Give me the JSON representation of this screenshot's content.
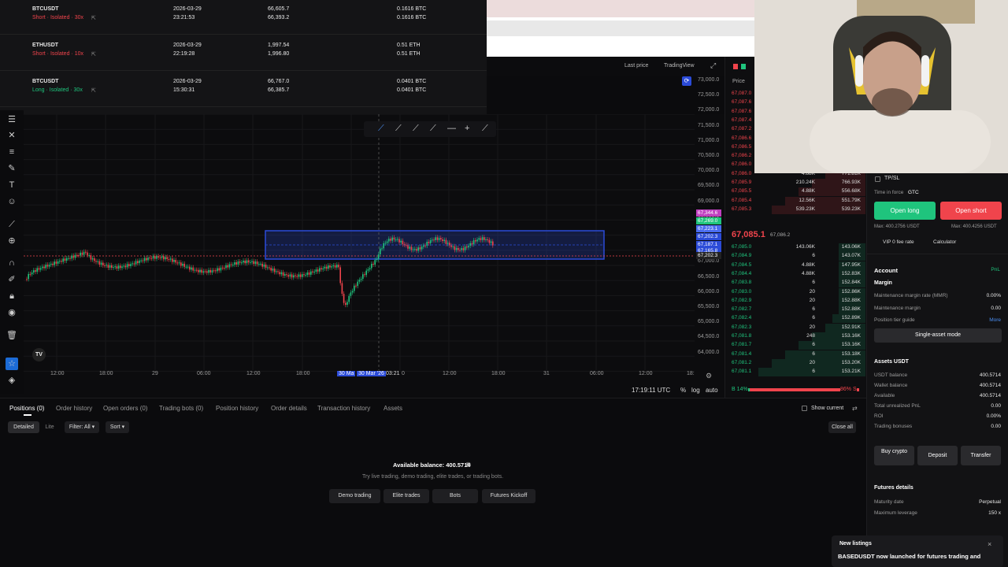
{
  "positions_history": [
    {
      "symbol": "BTCUSDT",
      "type": "Short · Isolated · 30x",
      "side": "short",
      "date": "2026-03-29",
      "time": "23:21:53",
      "open_price": "66,605.7",
      "close_price": "66,393.2",
      "size1": "0.1616 BTC",
      "size2": "0.1616 BTC"
    },
    {
      "symbol": "ETHUSDT",
      "type": "Short · Isolated · 10x",
      "side": "short",
      "date": "2026-03-29",
      "time": "22:19:28",
      "open_price": "1,997.54",
      "close_price": "1,996.80",
      "size1": "0.51 ETH",
      "size2": "0.51 ETH"
    },
    {
      "symbol": "BTCUSDT",
      "type": "Long · Isolated · 30x",
      "side": "long",
      "date": "2026-03-29",
      "time": "15:30:31",
      "open_price": "66,767.0",
      "close_price": "66,385.7",
      "size1": "0.0401 BTC",
      "size2": "0.0401 BTC"
    }
  ],
  "chart": {
    "price_mode": "Last price",
    "view": "TradingView",
    "price_label": "Price",
    "y_ticks": [
      "73,000.0",
      "72,500.0",
      "72,000.0",
      "71,500.0",
      "71,000.0",
      "70,500.0",
      "70,000.0",
      "69,500.0",
      "69,000.0",
      "68,500.0",
      "68,000.0",
      "67,500.0",
      "67,000.0",
      "66,500.0",
      "66,000.0",
      "65,500.0",
      "65,000.0",
      "64,500.0",
      "64,000.0"
    ],
    "x_ticks": [
      "12:00",
      "18:00",
      "29",
      "06:00",
      "12:00",
      "18:00",
      "30 Ma",
      "30 Mar '26",
      "03:21",
      "0",
      "12:00",
      "18:00",
      "31",
      "06:00",
      "12:00",
      "18:"
    ],
    "price_tags": [
      "67,344.6",
      "67,269.0",
      "67,223.1",
      "67,202.3",
      "67,187.1",
      "67,165.8",
      "67,202.3"
    ],
    "clock": "17:19:11 UTC",
    "pct": "%",
    "log": "log",
    "auto": "auto",
    "tv_logo": "TV",
    "colors": {
      "up": "#1fc47d",
      "down": "#f0444c",
      "box": "#2b4bd8"
    }
  },
  "order_book": {
    "asks": [
      [
        "67,087.0",
        "",
        ""
      ],
      [
        "67,087.6",
        "",
        ""
      ],
      [
        "67,087.6",
        "",
        ""
      ],
      [
        "67,087.4",
        "",
        ""
      ],
      [
        "67,087.2",
        "",
        ""
      ],
      [
        "67,086.6",
        "",
        ""
      ],
      [
        "67,086.5",
        "",
        ""
      ],
      [
        "67,086.2",
        "",
        ""
      ],
      [
        "67,086.0",
        "20",
        "771.84K"
      ],
      [
        "67,086.0",
        "4.88K",
        "771.81K"
      ],
      [
        "67,085.9",
        "210.24K",
        "766.93K"
      ],
      [
        "67,085.5",
        "4.88K",
        "556.68K"
      ],
      [
        "67,085.4",
        "12.56K",
        "551.79K"
      ],
      [
        "67,085.3",
        "539.23K",
        "539.23K"
      ]
    ],
    "mid_price": "67,085.1",
    "mid_sub": "67,086.2",
    "bids": [
      [
        "67,085.0",
        "143.06K",
        "143.06K"
      ],
      [
        "67,084.9",
        "6",
        "143.07K"
      ],
      [
        "67,084.5",
        "4.88K",
        "147.95K"
      ],
      [
        "67,084.4",
        "4.88K",
        "152.83K"
      ],
      [
        "67,083.8",
        "6",
        "152.84K"
      ],
      [
        "67,083.0",
        "20",
        "152.86K"
      ],
      [
        "67,082.9",
        "20",
        "152.88K"
      ],
      [
        "67,082.7",
        "6",
        "152.88K"
      ],
      [
        "67,082.4",
        "6",
        "152.89K"
      ],
      [
        "67,082.3",
        "20",
        "152.91K"
      ],
      [
        "67,081.8",
        "248",
        "153.16K"
      ],
      [
        "67,081.7",
        "6",
        "153.16K"
      ],
      [
        "67,081.4",
        "6",
        "153.18K"
      ],
      [
        "67,081.2",
        "20",
        "153.20K"
      ],
      [
        "67,081.1",
        "6",
        "153.21K"
      ]
    ],
    "buy_pct": "B 14%",
    "sell_pct": "86% S"
  },
  "trade_panel": {
    "tpsl": "TP/SL",
    "tif_label": "Time in force",
    "tif_value": "GTC",
    "open_long": "Open long",
    "open_short": "Open short",
    "max_long": "Max: 400.2756 USDT",
    "max_short": "Max: 400.4256 USDT",
    "vip": "VIP 0 fee rate",
    "calculator": "Calculator",
    "account": "Account",
    "pnl": "PnL",
    "margin": "Margin",
    "mmr_label": "Maintenance margin rate (MMR)",
    "mmr_value": "0.00%",
    "mm_label": "Maintenance margin",
    "mm_value": "0.00",
    "tier_label": "Position tier guide",
    "more": "More",
    "single_asset": "Single-asset mode",
    "assets_title": "Assets USDT",
    "assets": [
      [
        "USDT balance",
        "400.5714"
      ],
      [
        "Wallet balance",
        "400.5714"
      ],
      [
        "Available",
        "400.5714"
      ],
      [
        "Total unrealized PnL",
        "0.00"
      ],
      [
        "ROI",
        "0.00%"
      ],
      [
        "Trading bonuses",
        "0.00"
      ]
    ],
    "buy_crypto": "Buy crypto",
    "deposit": "Deposit",
    "transfer": "Transfer",
    "futures_details": "Futures details",
    "maturity_label": "Maturity date",
    "maturity_value": "Perpetual",
    "leverage_label": "Maximum leverage",
    "leverage_value": "150 x",
    "listing_title": "New listings",
    "listing_text": "BASEDUSDT now launched for futures trading and"
  },
  "bottom": {
    "tabs": [
      "Positions (0)",
      "Order history",
      "Open orders (0)",
      "Trading bots (0)",
      "Position history",
      "Order details",
      "Transaction history",
      "Assets"
    ],
    "show_current": "Show current",
    "detailed": "Detailed",
    "lite": "Lite",
    "filter": "Filter: All",
    "sort": "Sort",
    "close_all": "Close all",
    "available": "Available balance: 400.5714",
    "hint": "Try live trading, demo trading, elite trades, or trading bots.",
    "buttons": [
      "Demo trading",
      "Elite trades",
      "Bots",
      "Futures Kickoff"
    ]
  }
}
